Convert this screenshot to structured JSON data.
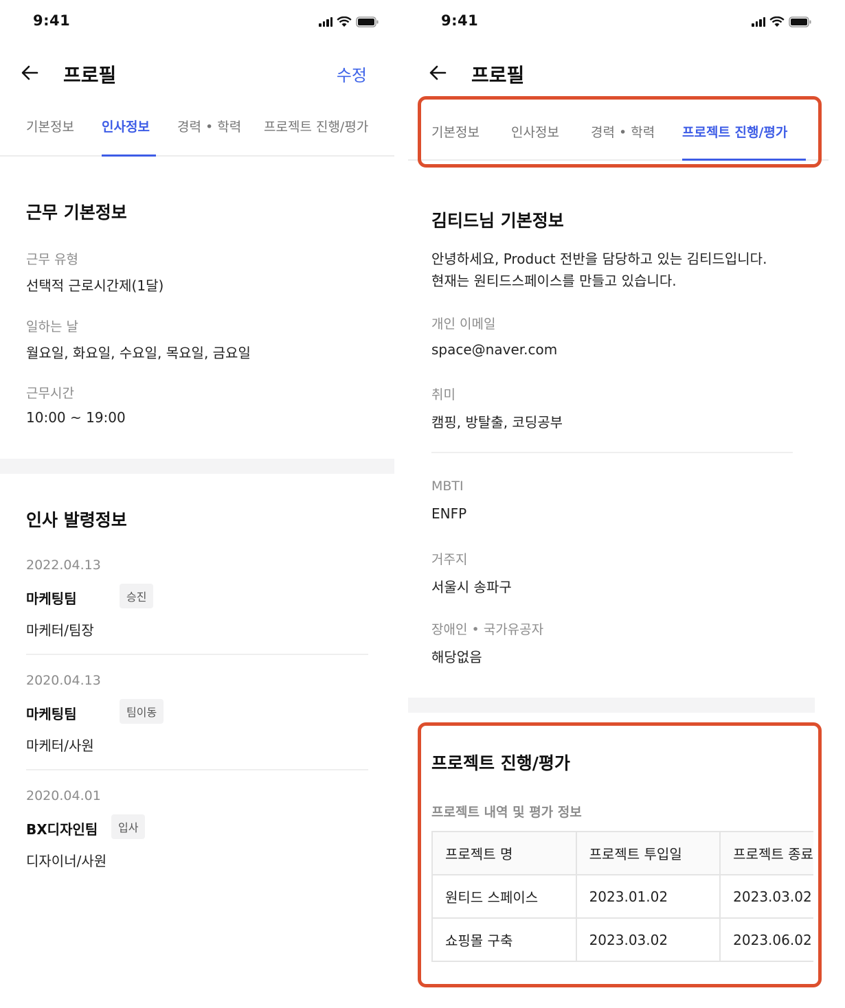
{
  "status": {
    "time": "9:41"
  },
  "left": {
    "header": {
      "title": "프로필",
      "edit_label": "수정"
    },
    "tabs": [
      "기본정보",
      "인사정보",
      "경력 • 학력",
      "프로젝트 진행/평가"
    ],
    "active_tab": "인사정보",
    "work_info": {
      "title": "근무 기본정보",
      "fields": [
        {
          "label": "근무 유형",
          "value": "선택적 근로시간제(1달)"
        },
        {
          "label": "일하는 날",
          "value": "월요일, 화요일, 수요일, 목요일, 금요일"
        },
        {
          "label": "근무시간",
          "value": "10:00 ~ 19:00"
        }
      ]
    },
    "hr_orders": {
      "title": "인사 발령정보",
      "entries": [
        {
          "date": "2022.04.13",
          "team": "마케팅팀",
          "badge": "승진",
          "role": "마케터/팀장"
        },
        {
          "date": "2020.04.13",
          "team": "마케팅팀",
          "badge": "팀이동",
          "role": "마케터/사원"
        },
        {
          "date": "2020.04.01",
          "team": "BX디자인팀",
          "badge": "입사",
          "role": "디자이너/사원"
        }
      ]
    }
  },
  "right": {
    "header": {
      "title": "프로필"
    },
    "tabs": [
      "기본정보",
      "인사정보",
      "경력 • 학력",
      "프로젝트 진행/평가"
    ],
    "active_tab": "프로젝트 진행/평가",
    "basic": {
      "title": "김티드님 기본정보",
      "intro_line1": "안녕하세요, Product 전반을 담당하고 있는 김티드입니다.",
      "intro_line2": "현재는 원티드스페이스를 만들고 있습니다.",
      "fields": [
        {
          "label": "개인 이메일",
          "value": "space@naver.com"
        },
        {
          "label": "취미",
          "value": "캠핑, 방탈출, 코딩공부"
        },
        {
          "label": "MBTI",
          "value": "ENFP"
        },
        {
          "label": "거주지",
          "value": "서울시 송파구"
        },
        {
          "label": "장애인 • 국가유공자",
          "value": "해당없음"
        }
      ]
    },
    "project": {
      "title": "프로젝트 진행/평가",
      "subtitle": "프로젝트 내역 및 평가 정보",
      "columns": [
        "프로젝트 명",
        "프로젝트 투입일",
        "프로젝트 종료"
      ],
      "rows": [
        [
          "원티드 스페이스",
          "2023.01.02",
          "2023.03.02"
        ],
        [
          "쇼핑몰 구축",
          "2023.03.02",
          "2023.06.02"
        ]
      ]
    }
  },
  "colors": {
    "accent": "#3d5ce6",
    "highlight": "#dd4f2d"
  },
  "icons": [
    "back-arrow-icon",
    "signal-icon",
    "wifi-icon",
    "battery-icon"
  ]
}
